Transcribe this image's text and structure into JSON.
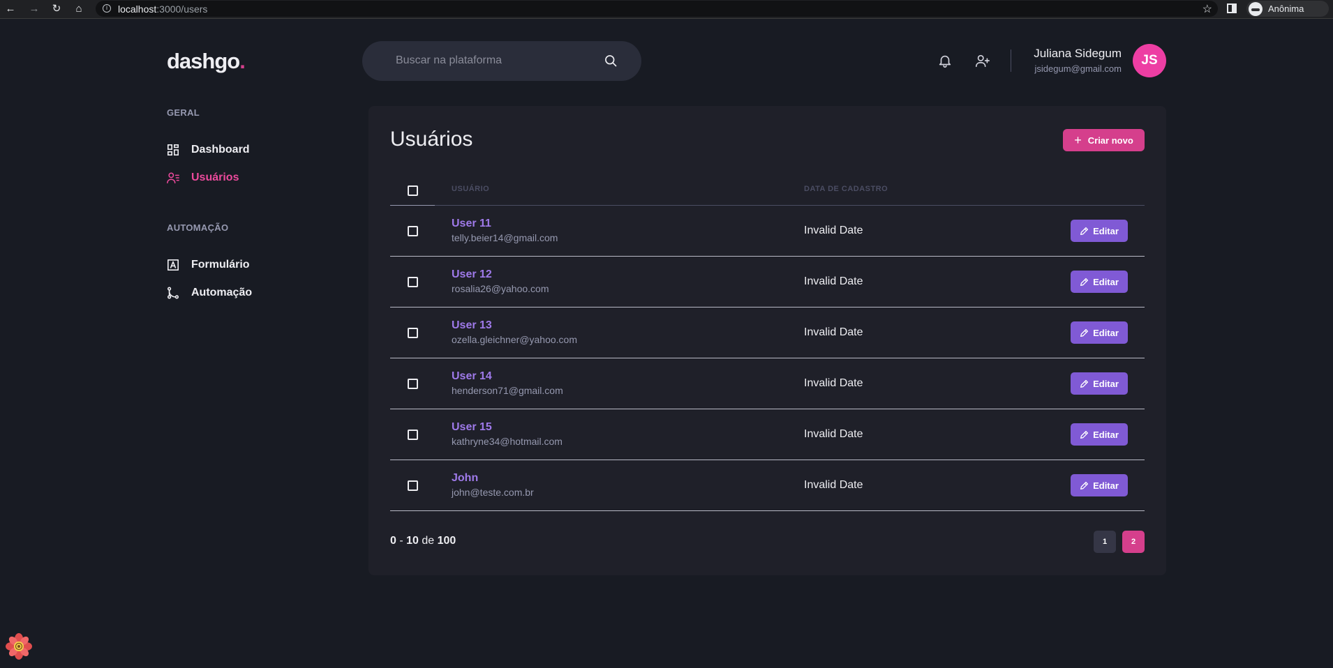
{
  "browser": {
    "url_host": "localhost",
    "url_path": ":3000/users",
    "profile_label": "Anônima"
  },
  "header": {
    "logo_text": "dashgo",
    "logo_dot": ".",
    "search_placeholder": "Buscar na plataforma",
    "user_name": "Juliana Sidegum",
    "user_email": "jsidegum@gmail.com",
    "avatar_initials": "JS"
  },
  "sidebar": {
    "sections": [
      {
        "title": "GERAL",
        "items": [
          {
            "label": "Dashboard",
            "icon": "dashboard-icon"
          },
          {
            "label": "Usuários",
            "icon": "users-icon",
            "active": true
          }
        ]
      },
      {
        "title": "AUTOMAÇÃO",
        "items": [
          {
            "label": "Formulário",
            "icon": "form-icon"
          },
          {
            "label": "Automação",
            "icon": "git-merge-icon"
          }
        ]
      }
    ]
  },
  "main": {
    "title": "Usuários",
    "create_label": "Criar novo",
    "columns": {
      "user": "USUÁRIO",
      "date": "DATA DE CADASTRO"
    },
    "edit_label": "Editar",
    "rows": [
      {
        "name": "User 11",
        "email": "telly.beier14@gmail.com",
        "date": "Invalid Date"
      },
      {
        "name": "User 12",
        "email": "rosalia26@yahoo.com",
        "date": "Invalid Date"
      },
      {
        "name": "User 13",
        "email": "ozella.gleichner@yahoo.com",
        "date": "Invalid Date"
      },
      {
        "name": "User 14",
        "email": "henderson71@gmail.com",
        "date": "Invalid Date"
      },
      {
        "name": "User 15",
        "email": "kathryne34@hotmail.com",
        "date": "Invalid Date"
      },
      {
        "name": "John",
        "email": "john@teste.com.br",
        "date": "Invalid Date"
      }
    ],
    "pagination": {
      "from": "0",
      "sep": " - ",
      "to": "10",
      "of_label": " de ",
      "total": "100",
      "pages": [
        "1",
        "2"
      ],
      "current_page": "2"
    }
  },
  "colors": {
    "accent_pink": "#d53f8c",
    "accent_purple": "#805ad5",
    "background": "#181b23",
    "card": "#1f2029"
  }
}
